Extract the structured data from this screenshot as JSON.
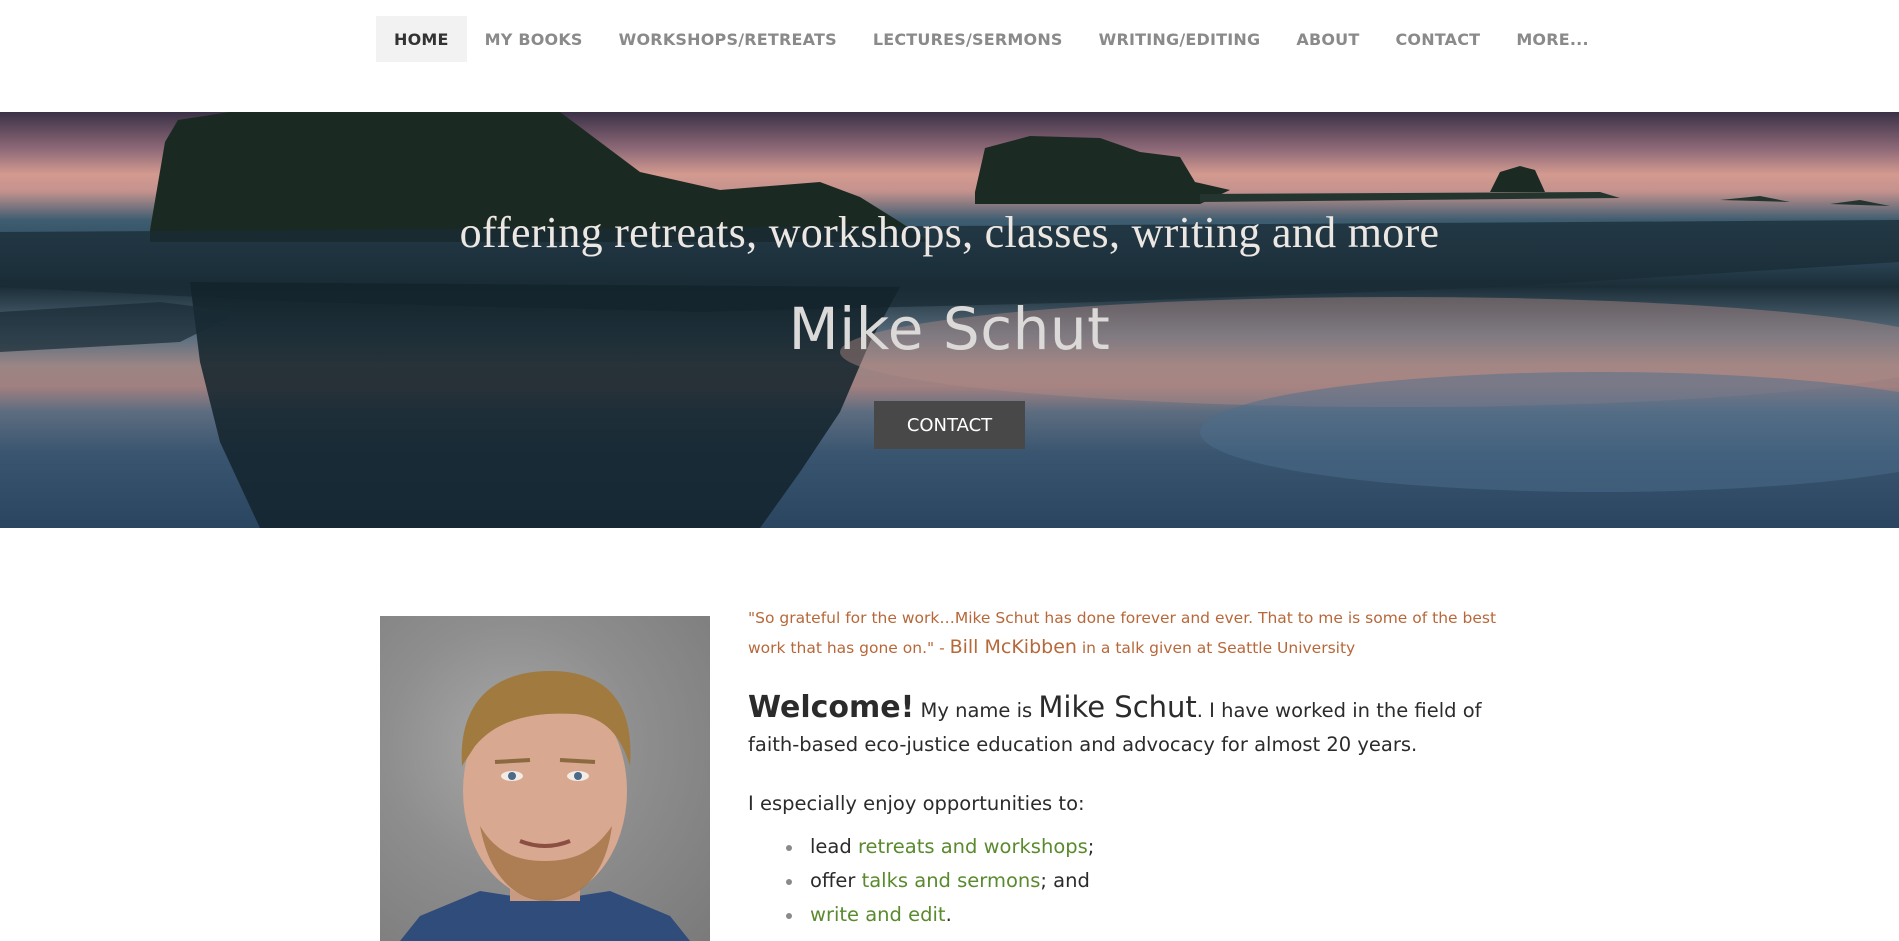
{
  "nav": {
    "items": [
      {
        "label": "HOME",
        "active": true
      },
      {
        "label": "MY BOOKS",
        "active": false
      },
      {
        "label": "WORKSHOPS/RETREATS",
        "active": false
      },
      {
        "label": "LECTURES/SERMONS",
        "active": false
      },
      {
        "label": "WRITING/EDITING",
        "active": false
      },
      {
        "label": "ABOUT",
        "active": false
      },
      {
        "label": "CONTACT",
        "active": false
      },
      {
        "label": "MORE...",
        "active": false
      }
    ]
  },
  "hero": {
    "tagline": "offering retreats, workshops, classes, writing and more",
    "name": "Mike Schut",
    "button_label": "CONTACT",
    "image": "sunset-beach-sea-stacks-reflection"
  },
  "content": {
    "photo": "portrait-photo",
    "quote": {
      "text": "\"So grateful for the work…Mike Schut has done forever and ever. That to me is some of the best work that has gone on.\" - ",
      "author": "Bill McKibben",
      "context": " in a talk given at Seattle University"
    },
    "welcome": {
      "greeting": "Welcome!",
      "intro": " My name is ",
      "name": "Mike Schut",
      "rest": ". I have worked in the field of faith-based eco-justice education and advocacy for almost 20 years."
    },
    "enjoy_heading": "I especially enjoy opportunities to:",
    "opportunities": [
      {
        "prefix": "lead ",
        "link": "retreats and workshops",
        "suffix": ";"
      },
      {
        "prefix": "offer ",
        "link": "talks and sermons",
        "suffix": "; and"
      },
      {
        "prefix": "",
        "link": "write and edit",
        "suffix": "."
      }
    ]
  },
  "colors": {
    "quote": "#b7683a",
    "link": "#5a8a2e",
    "button": "#484848",
    "active_nav_bg": "#f2f2f2"
  }
}
